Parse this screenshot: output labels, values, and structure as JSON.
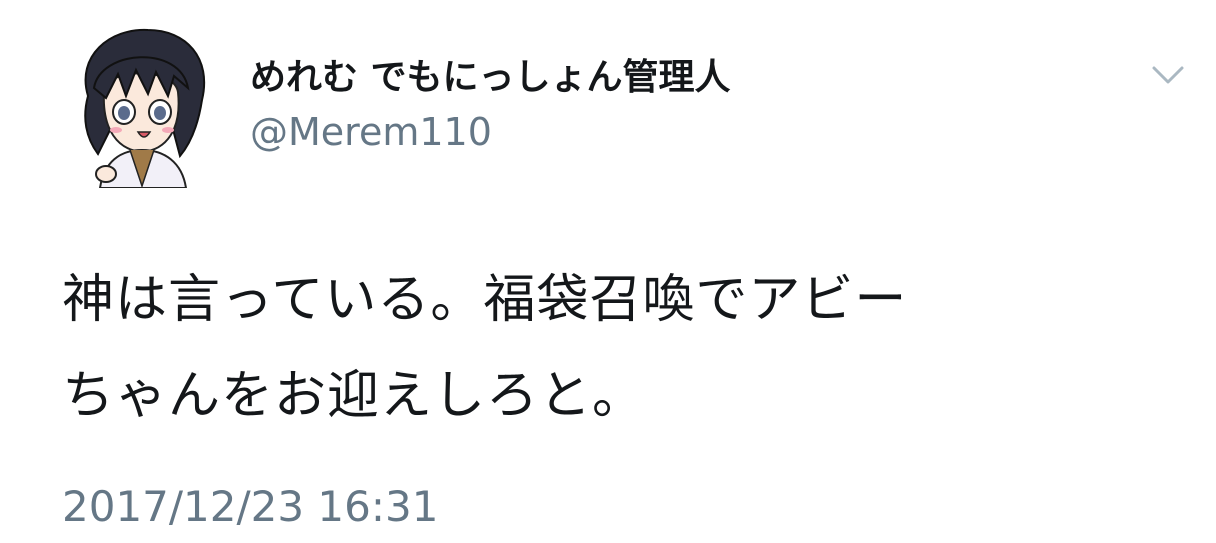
{
  "tweet": {
    "display_name": "めれむ でもにっしょん管理人",
    "handle": "@Merem110",
    "text_line1": "神は言っている。福袋召喚でアビー",
    "text_line2": "ちゃんをお迎えしろと。",
    "timestamp": "2017/12/23 16:31"
  },
  "icons": {
    "more": "chevron-down-icon",
    "avatar": "cartoon-avatar"
  },
  "colors": {
    "text_primary": "#14171a",
    "text_secondary": "#657786",
    "chevron": "#aab8c2"
  }
}
